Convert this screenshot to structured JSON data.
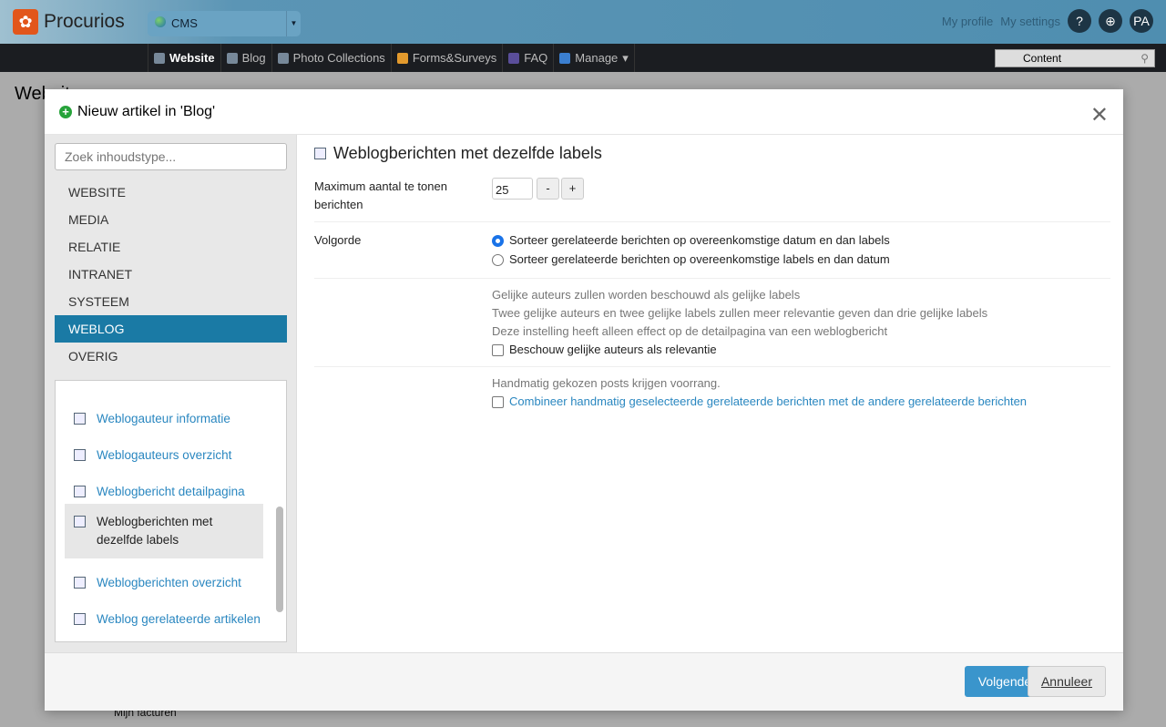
{
  "header": {
    "brand": "Procurios",
    "app_select": "CMS",
    "my_profile": "My profile",
    "my_settings": "My settings",
    "help": "?",
    "avatar": "PA"
  },
  "nav": {
    "items": [
      "Website",
      "Blog",
      "Photo Collections",
      "Forms&Surveys",
      "FAQ",
      "Manage"
    ],
    "search_value": "Content"
  },
  "background": {
    "title": "Website",
    "footer_item": "Mijn facturen"
  },
  "modal": {
    "title": "Nieuw artikel in 'Blog'",
    "search_placeholder": "Zoek inhoudstype...",
    "categories": [
      "WEBSITE",
      "MEDIA",
      "RELATIE",
      "INTRANET",
      "SYSTEEM",
      "WEBLOG",
      "OVERIG"
    ],
    "selected_category": "WEBLOG",
    "types": [
      "Weblogauteur informatie",
      "Weblogauteurs overzicht",
      "Weblogbericht detailpagina",
      "Weblogberichten met dezelfde labels",
      "Weblogberichten overzicht",
      "Weblog gerelateerde artikelen"
    ],
    "selected_type": "Weblogberichten met dezelfde labels",
    "content": {
      "heading": "Weblogberichten met dezelfde labels",
      "max_label": "Maximum aantal te tonen berichten",
      "max_value": "25",
      "minus": "-",
      "plus": "+",
      "order_label": "Volgorde",
      "order_options": [
        "Sorteer gerelateerde berichten op overeenkomstige datum en dan labels",
        "Sorteer gerelateerde berichten op overeenkomstige labels en dan datum"
      ],
      "order_selected": 0,
      "authors_info": [
        "Gelijke auteurs zullen worden beschouwd als gelijke labels",
        "Twee gelijke auteurs en twee gelijke labels zullen meer relevantie geven dan drie gelijke labels",
        "Deze instelling heeft alleen effect op de detailpagina van een weblogbericht"
      ],
      "authors_checkbox": "Beschouw gelijke auteurs als relevantie",
      "manual_info": "Handmatig gekozen posts krijgen voorrang.",
      "manual_checkbox": "Combineer handmatig geselecteerde gerelateerde berichten met de andere gerelateerde berichten"
    },
    "next": "Volgende",
    "cancel": "Annuleer"
  }
}
